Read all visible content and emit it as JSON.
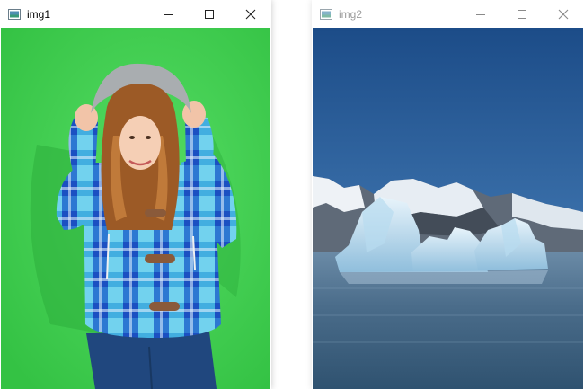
{
  "windows": [
    {
      "title": "img1",
      "state": "active",
      "image": "woman-in-hooded-plaid-jacket-green-screen"
    },
    {
      "title": "img2",
      "state": "inactive",
      "image": "icebergs-in-lake-with-snowy-mountains"
    }
  ],
  "caption_buttons": [
    "minimize-icon",
    "maximize-icon",
    "close-icon"
  ],
  "colors": {
    "green_screen": "#3fcf4f",
    "sky_top": "#1d4f8a",
    "sky_bottom": "#6f9fcc",
    "water": "#4d6f8c",
    "ice": "#cfe6f4",
    "inactive_title": "#9a9a9a"
  }
}
